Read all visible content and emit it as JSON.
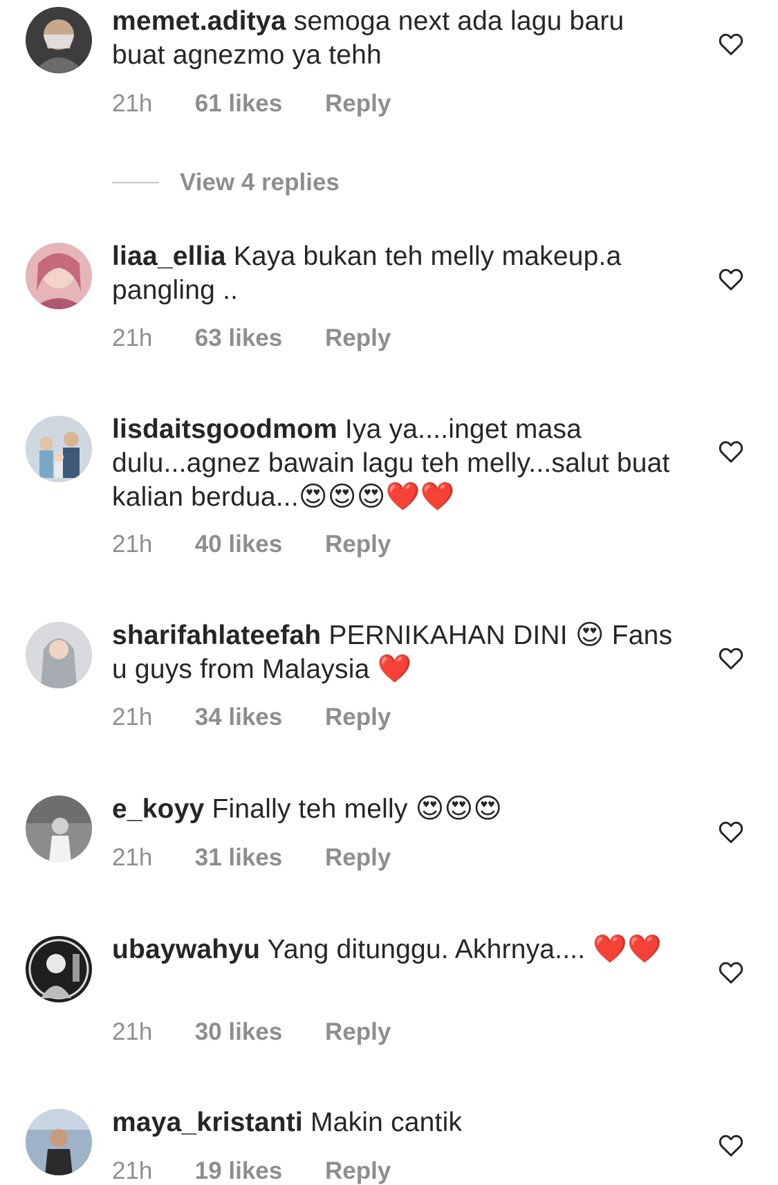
{
  "comments": [
    {
      "username": "memet.aditya",
      "text": "semoga next ada lagu baru buat agnezmo ya tehh",
      "emoji": "",
      "time": "21h",
      "likes": "61 likes",
      "reply": "Reply",
      "avatar_color": "#4a4a4a"
    },
    {
      "username": "liaa_ellia",
      "text": "Kaya bukan teh melly makeup.a pangling ..",
      "emoji": "",
      "time": "21h",
      "likes": "63 likes",
      "reply": "Reply",
      "avatar_color": "#d98a9a"
    },
    {
      "username": "lisdaitsgoodmom",
      "text": "Iya ya....inget masa dulu...agnez bawain lagu teh melly...salut buat kalian berdua...",
      "emoji": "😍😍😍❤️❤️",
      "time": "21h",
      "likes": "40 likes",
      "reply": "Reply",
      "avatar_color": "#8aa0b8"
    },
    {
      "username": "sharifahlateefah",
      "text": "PERNIKAHAN DINI",
      "emoji": "😍",
      "text2": "Fans u guys from Malaysia",
      "emoji2": "❤️",
      "time": "21h",
      "likes": "34 likes",
      "reply": "Reply",
      "avatar_color": "#b9bcc2"
    },
    {
      "username": "e_koyy",
      "text": "Finally teh melly",
      "emoji": "😍😍😍",
      "time": "21h",
      "likes": "31 likes",
      "reply": "Reply",
      "avatar_color": "#9a9a9a"
    },
    {
      "username": "ubaywahyu",
      "text": "Yang ditunggu. Akhrnya....",
      "emoji": "❤️❤️",
      "time": "21h",
      "likes": "30 likes",
      "reply": "Reply",
      "avatar_color": "#2b2b2b"
    },
    {
      "username": "maya_kristanti",
      "text": "Makin cantik",
      "emoji": "",
      "time": "21h",
      "likes": "19 likes",
      "reply": "Reply",
      "avatar_color": "#7c8ea3"
    }
  ],
  "view_replies": "View 4 replies",
  "icons": {
    "like": "heart-outline-icon"
  },
  "colors": {
    "text": "#262626",
    "meta": "#8e8e8e",
    "line": "#c7c7c7"
  }
}
